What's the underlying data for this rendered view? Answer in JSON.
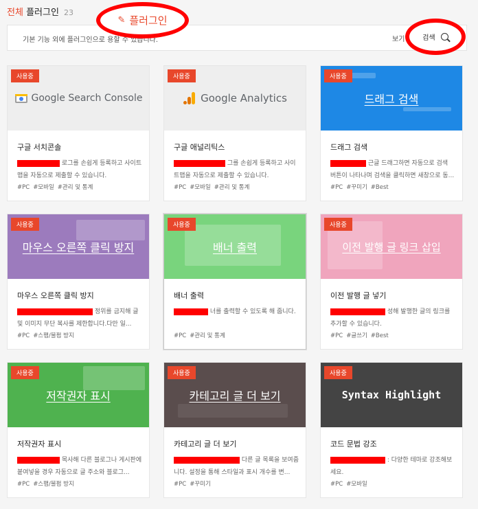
{
  "header": {
    "title_accent": "전체",
    "title_main": "플러그인",
    "count": "23"
  },
  "annotation": {
    "plugin_label": "플러그인",
    "search_label": "검색"
  },
  "infobar": {
    "description": "기본 기능 외에 플러그인으로                                                                      용할 수 있습니다.",
    "more_label": "보기"
  },
  "colors": {
    "accent": "#e8472b",
    "annotation_red": "#ff0000"
  },
  "cards": [
    {
      "badge": "사용중",
      "banner_text": "Google Search Console",
      "name": "구글 서치콘솔",
      "desc": "로그를 손쉽게 등록하고 사이트맵을 자동으로 제출할 수 있습니다.",
      "tags": [
        "#PC",
        "#모바일",
        "#관리 및 통계"
      ],
      "banner_color": "#eeeeee"
    },
    {
      "badge": "사용중",
      "banner_text": "Google Analytics",
      "name": "구글 애널리틱스",
      "desc": "그를 손쉽게 등록하고 사이트맵을 자동으로 제출할 수 있습니다.",
      "tags": [
        "#PC",
        "#모바일",
        "#관리 및 통계"
      ],
      "banner_color": "#eeeeee"
    },
    {
      "badge": "사용중",
      "banner_text": "드래그 검색",
      "name": "드래그 검색",
      "desc": "근글 드래그하면 자동으로 검색 버튼이 나타나며 검색을 클릭하면 새창으로 동...",
      "tags": [
        "#PC",
        "#꾸미기",
        "#Best"
      ],
      "banner_color": "#1e88e5"
    },
    {
      "badge": "사용중",
      "banner_text": "마우스 오른쪽 클릭 방지",
      "name": "마우스 오른쪽 클릭 방지",
      "desc": "정위를 금지해 글 및 이미지 무단 복사를 제한합니다.다만 일...",
      "tags": [
        "#PC",
        "#스팸/불펌 방지"
      ],
      "banner_color": "#9c7bbd"
    },
    {
      "badge": "사용중",
      "banner_text": "배너 출력",
      "name": "배너 출력",
      "desc": "너를 출력할 수 있도록 해 줍니다.",
      "tags": [
        "#PC",
        "#관리 및 통계"
      ],
      "banner_color": "#79d47d"
    },
    {
      "badge": "사용중",
      "banner_text": "이전 발행 글 링크 삽입",
      "name": "이전 발행 글 넣기",
      "desc": "성해 발행한 글의 링크를 추가할 수 있습니다.",
      "tags": [
        "#PC",
        "#글쓰기",
        "#Best"
      ],
      "banner_color": "#f0a5bd"
    },
    {
      "badge": "사용중",
      "banner_text": "저작권자 표시",
      "name": "저작권자 표시",
      "desc": "목사해 다른 블로그나 게시판에 붙여넣을 경우 자동으로 글 주소와 블로그...",
      "tags": [
        "#PC",
        "#스팸/불펌 방지"
      ],
      "banner_color": "#4fb24f"
    },
    {
      "badge": "사용중",
      "banner_text": "카테고리 글 더 보기",
      "name": "카테고리 글 더 보기",
      "desc": "다른 글 목록을 보여줍니다. 설정을 통해 스타일과 표시 개수를 변...",
      "tags": [
        "#PC",
        "#꾸미기"
      ],
      "banner_color": "#5a4d4d"
    },
    {
      "badge": "사용중",
      "banner_text": "Syntax Highlight",
      "name": "코드 문법 강조",
      "desc": ": 다양한 테마로 강조해보세요.",
      "tags": [
        "#PC",
        "#모바일"
      ],
      "banner_color": "#444444"
    }
  ]
}
